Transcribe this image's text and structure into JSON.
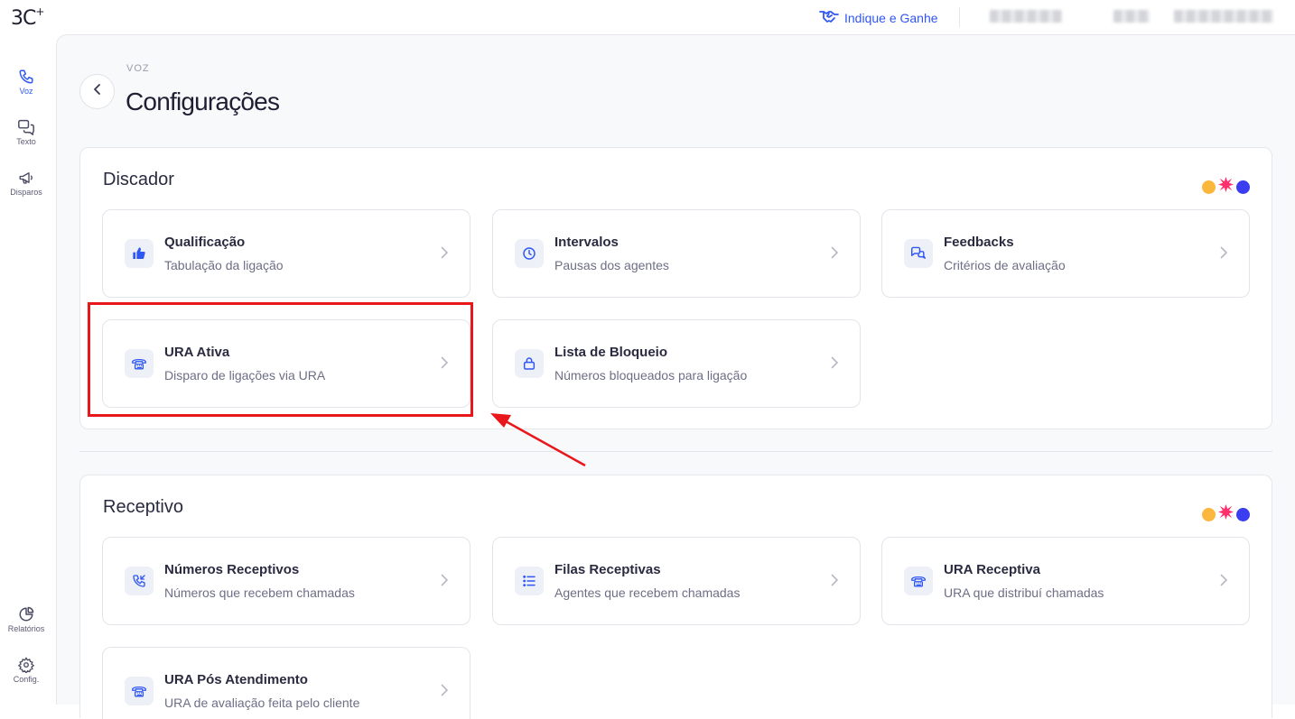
{
  "header": {
    "logo": "3C",
    "logo_sup": "+",
    "indique_label": "Indique e Ganhe"
  },
  "sidebar": {
    "items": [
      {
        "label": "Voz",
        "icon": "phone-icon",
        "active": true
      },
      {
        "label": "Texto",
        "icon": "chat-icon",
        "active": false
      },
      {
        "label": "Disparos",
        "icon": "megaphone-icon",
        "active": false
      },
      {
        "label": "Relatórios",
        "icon": "pie-chart-icon",
        "active": false
      },
      {
        "label": "Config.",
        "icon": "gear-icon",
        "active": false
      }
    ]
  },
  "page": {
    "breadcrumb": "VOZ",
    "title": "Configurações"
  },
  "sections": [
    {
      "title": "Discador",
      "cards": [
        {
          "title": "Qualificação",
          "subtitle": "Tabulação da ligação",
          "icon": "thumbs-up-icon"
        },
        {
          "title": "Intervalos",
          "subtitle": "Pausas dos agentes",
          "icon": "clock-icon"
        },
        {
          "title": "Feedbacks",
          "subtitle": "Critérios de avaliação",
          "icon": "chat-bubbles-icon"
        },
        {
          "title": "URA Ativa",
          "subtitle": "Disparo de ligações via URA",
          "icon": "ura-phone-icon"
        },
        {
          "title": "Lista de Bloqueio",
          "subtitle": "Números bloqueados para ligação",
          "icon": "lock-icon"
        }
      ]
    },
    {
      "title": "Receptivo",
      "cards": [
        {
          "title": "Números Receptivos",
          "subtitle": "Números que recebem chamadas",
          "icon": "incoming-call-icon"
        },
        {
          "title": "Filas Receptivas",
          "subtitle": "Agentes que recebem chamadas",
          "icon": "list-icon"
        },
        {
          "title": "URA Receptiva",
          "subtitle": "URA que distribuí chamadas",
          "icon": "ura-phone-icon"
        },
        {
          "title": "URA Pós Atendimento",
          "subtitle": "URA de avaliação feita pelo cliente",
          "icon": "ura-phone-icon"
        }
      ]
    }
  ],
  "colors": {
    "accent": "#3057f2",
    "dot_yellow": "#fbb73c",
    "dot_pink": "#ff2f6e",
    "dot_blue": "#3b3df0",
    "highlight": "#e8171b"
  }
}
